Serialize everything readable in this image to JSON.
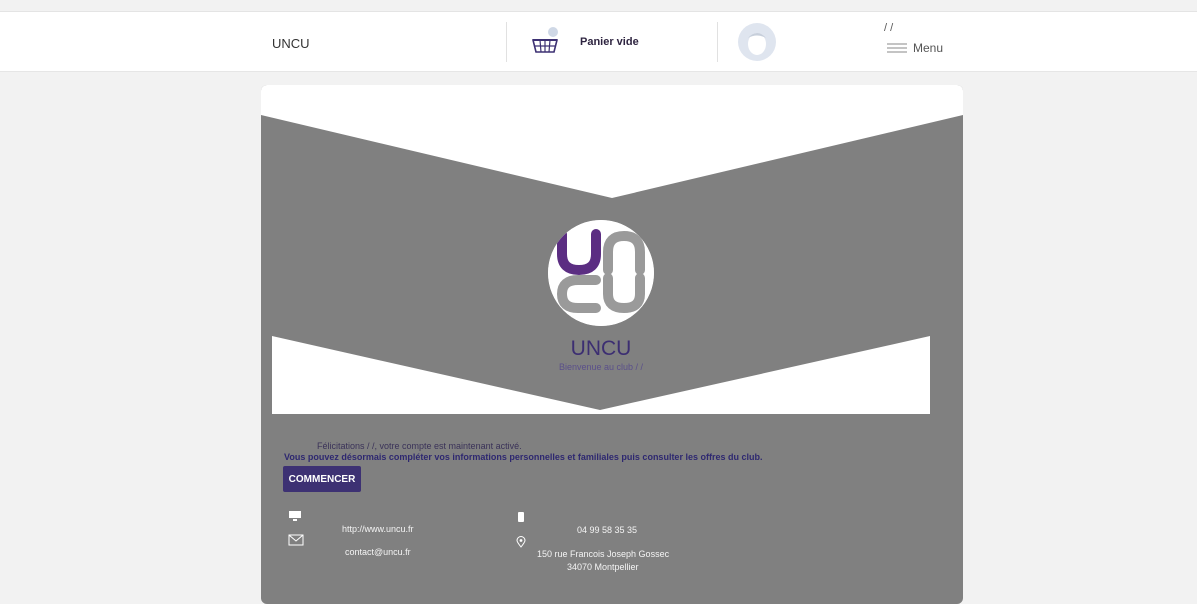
{
  "header": {
    "brand": "UNCU",
    "cart_label": "Panier vide",
    "user_name": "/ /",
    "menu_label": "Menu"
  },
  "card": {
    "club_name": "UNCU",
    "welcome": "Bienvenue au club / /",
    "congrats": "Félicitations / /, votre compte est maintenant activé.",
    "info": "Vous pouvez désormais compléter vos informations personnelles et familiales puis consulter les offres du club.",
    "start_label": "COMMENCER"
  },
  "footer": {
    "website": "http://www.uncu.fr",
    "email": "contact@uncu.fr",
    "phone": "04 99 58 35 35",
    "address_line1": "150 rue Francois Joseph Gossec",
    "address_line2": "34070 Montpellier"
  },
  "icons": {
    "cart": "basket-icon",
    "avatar": "user-avatar-icon",
    "menu": "hamburger-icon",
    "website": "monitor-icon",
    "email": "envelope-icon",
    "phone": "mobile-icon",
    "address": "location-pin-icon"
  },
  "colors": {
    "accent": "#3d3173",
    "logo_purple": "#5b2d82",
    "logo_gray": "#9a9a9a",
    "card_gray": "#808080"
  }
}
